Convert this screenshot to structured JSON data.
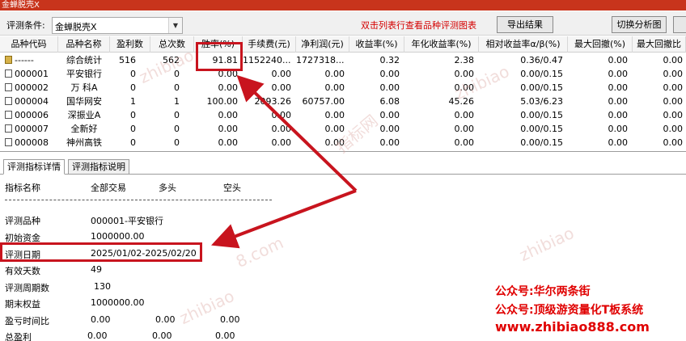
{
  "window": {
    "title": "金蝉脱壳X"
  },
  "toolbar": {
    "condition_label": "评测条件:",
    "condition_value": "金蝉脱壳X",
    "hint": "双击列表行查看品种评测图表",
    "export_button": "导出结果",
    "switch_button": "切换分析图"
  },
  "grid": {
    "headers": [
      "品种代码",
      "品种名称",
      "盈利数",
      "总次数",
      "胜率(%)",
      "手续费(元)",
      "净利润(元)",
      "收益率(%)",
      "年化收益率(%)",
      "相对收益率α/β(%)",
      "最大回撤(%)",
      "最大回撤比"
    ],
    "rows": [
      {
        "code": "------",
        "name": "综合统计",
        "wins": "516",
        "total": "562",
        "win_rate": "91.81",
        "fee": "1152240....",
        "net_profit": "1727318....",
        "return": "0.32",
        "annual": "2.38",
        "relative": "0.36/0.47",
        "max_dd": "0.00",
        "dd_ratio": "0.00"
      },
      {
        "code": "000001",
        "name": "平安银行",
        "wins": "0",
        "total": "0",
        "win_rate": "0.00",
        "fee": "0.00",
        "net_profit": "0.00",
        "return": "0.00",
        "annual": "0.00",
        "relative": "0.00/0.15",
        "max_dd": "0.00",
        "dd_ratio": "0.00"
      },
      {
        "code": "000002",
        "name": "万 科A",
        "wins": "0",
        "total": "0",
        "win_rate": "0.00",
        "fee": "0.00",
        "net_profit": "0.00",
        "return": "0.00",
        "annual": "0.00",
        "relative": "0.00/0.15",
        "max_dd": "0.00",
        "dd_ratio": "0.00"
      },
      {
        "code": "000004",
        "name": "国华网安",
        "wins": "1",
        "total": "1",
        "win_rate": "100.00",
        "fee": "2093.26",
        "net_profit": "60757.00",
        "return": "6.08",
        "annual": "45.26",
        "relative": "5.03/6.23",
        "max_dd": "0.00",
        "dd_ratio": "0.00"
      },
      {
        "code": "000006",
        "name": "深振业A",
        "wins": "0",
        "total": "0",
        "win_rate": "0.00",
        "fee": "0.00",
        "net_profit": "0.00",
        "return": "0.00",
        "annual": "0.00",
        "relative": "0.00/0.15",
        "max_dd": "0.00",
        "dd_ratio": "0.00"
      },
      {
        "code": "000007",
        "name": "全新好",
        "wins": "0",
        "total": "0",
        "win_rate": "0.00",
        "fee": "0.00",
        "net_profit": "0.00",
        "return": "0.00",
        "annual": "0.00",
        "relative": "0.00/0.15",
        "max_dd": "0.00",
        "dd_ratio": "0.00"
      },
      {
        "code": "000008",
        "name": "神州高铁",
        "wins": "0",
        "total": "0",
        "win_rate": "0.00",
        "fee": "0.00",
        "net_profit": "0.00",
        "return": "0.00",
        "annual": "0.00",
        "relative": "0.00/0.15",
        "max_dd": "0.00",
        "dd_ratio": "0.00"
      }
    ]
  },
  "tabs": [
    "评测指标详情",
    "评测指标说明"
  ],
  "details": {
    "col_headers": [
      "指标名称",
      "全部交易",
      "多头",
      "空头"
    ],
    "product_label": "评测品种",
    "product_value": "000001-平安银行",
    "capital_label": "初始资金",
    "capital_value": "1000000.00",
    "date_label": "评测日期",
    "date_value": "2025/01/02-2025/02/20",
    "valid_days_label": "有效天数",
    "valid_days_value": "49",
    "period_label": "评测周期数",
    "period_value": "130",
    "final_label": "期末权益",
    "final_value": "1000000.00",
    "pl_ratio_label": "盈亏时间比",
    "pl_ratio_values": [
      "0.00",
      "0.00",
      "0.00"
    ],
    "total_profit_label": "总盈利",
    "total_profit_values": [
      "0.00",
      "0.00",
      "0.00"
    ]
  },
  "watermark": {
    "text1": "zhibiao",
    "text2": "指标网",
    "text3": "8.com"
  },
  "promo": {
    "line1": "公众号:华尔两条街",
    "line2": "公众号:顶级游资量化T板系统",
    "url": "www.zhibiao888.com"
  },
  "colors": {
    "titlebar": "#c8341c",
    "hint": "#d40000",
    "highlight": "#c8141e",
    "promo": "#e00000"
  },
  "icons": {
    "combo_arrow": "chevron-down-icon",
    "row_checkbox": "checkbox-icon"
  }
}
